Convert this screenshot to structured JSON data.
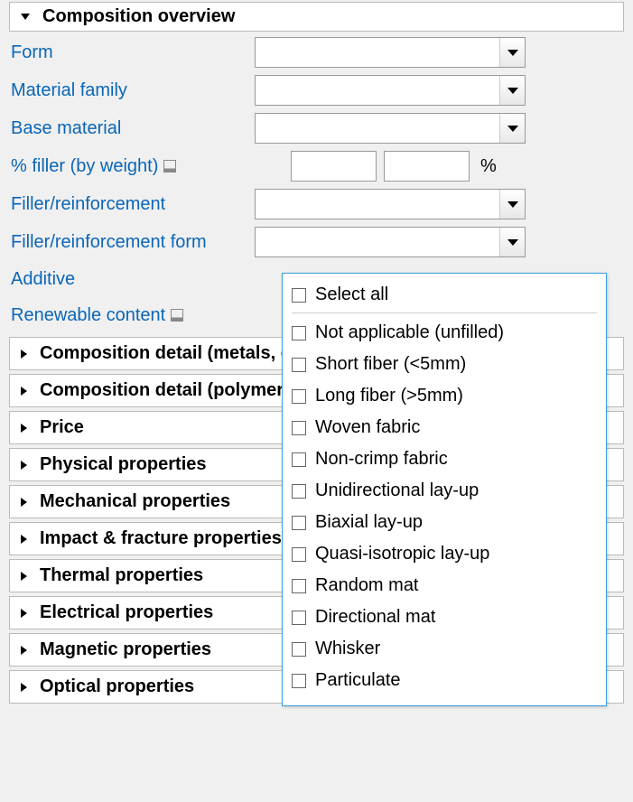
{
  "sections": {
    "composition_overview": "Composition overview"
  },
  "fields": {
    "form": {
      "label": "Form",
      "value": ""
    },
    "material_family": {
      "label": "Material family",
      "value": ""
    },
    "base_material": {
      "label": "Base material",
      "value": ""
    },
    "filler_pct": {
      "label": "% filler (by weight)",
      "from": "",
      "to": "",
      "unit": "%"
    },
    "filler_reinforcement": {
      "label": "Filler/reinforcement",
      "value": ""
    },
    "filler_reinforcement_form": {
      "label": "Filler/reinforcement form",
      "value": ""
    },
    "additive": {
      "label": "Additive"
    },
    "renewable_content": {
      "label": "Renewable content"
    }
  },
  "collapsed_sections": [
    "Composition detail (metals, ceramics and glasses)",
    "Composition detail (polymers and natural materials)",
    "Price",
    "Physical properties",
    "Mechanical properties",
    "Impact & fracture properties",
    "Thermal properties",
    "Electrical properties",
    "Magnetic properties",
    "Optical properties"
  ],
  "dropdown_options": {
    "select_all": "Select all",
    "items": [
      "Not applicable (unfilled)",
      "Short fiber (<5mm)",
      "Long fiber (>5mm)",
      "Woven fabric",
      "Non-crimp fabric",
      "Unidirectional lay-up",
      "Biaxial lay-up",
      "Quasi-isotropic lay-up",
      "Random mat",
      "Directional mat",
      "Whisker",
      "Particulate"
    ]
  }
}
